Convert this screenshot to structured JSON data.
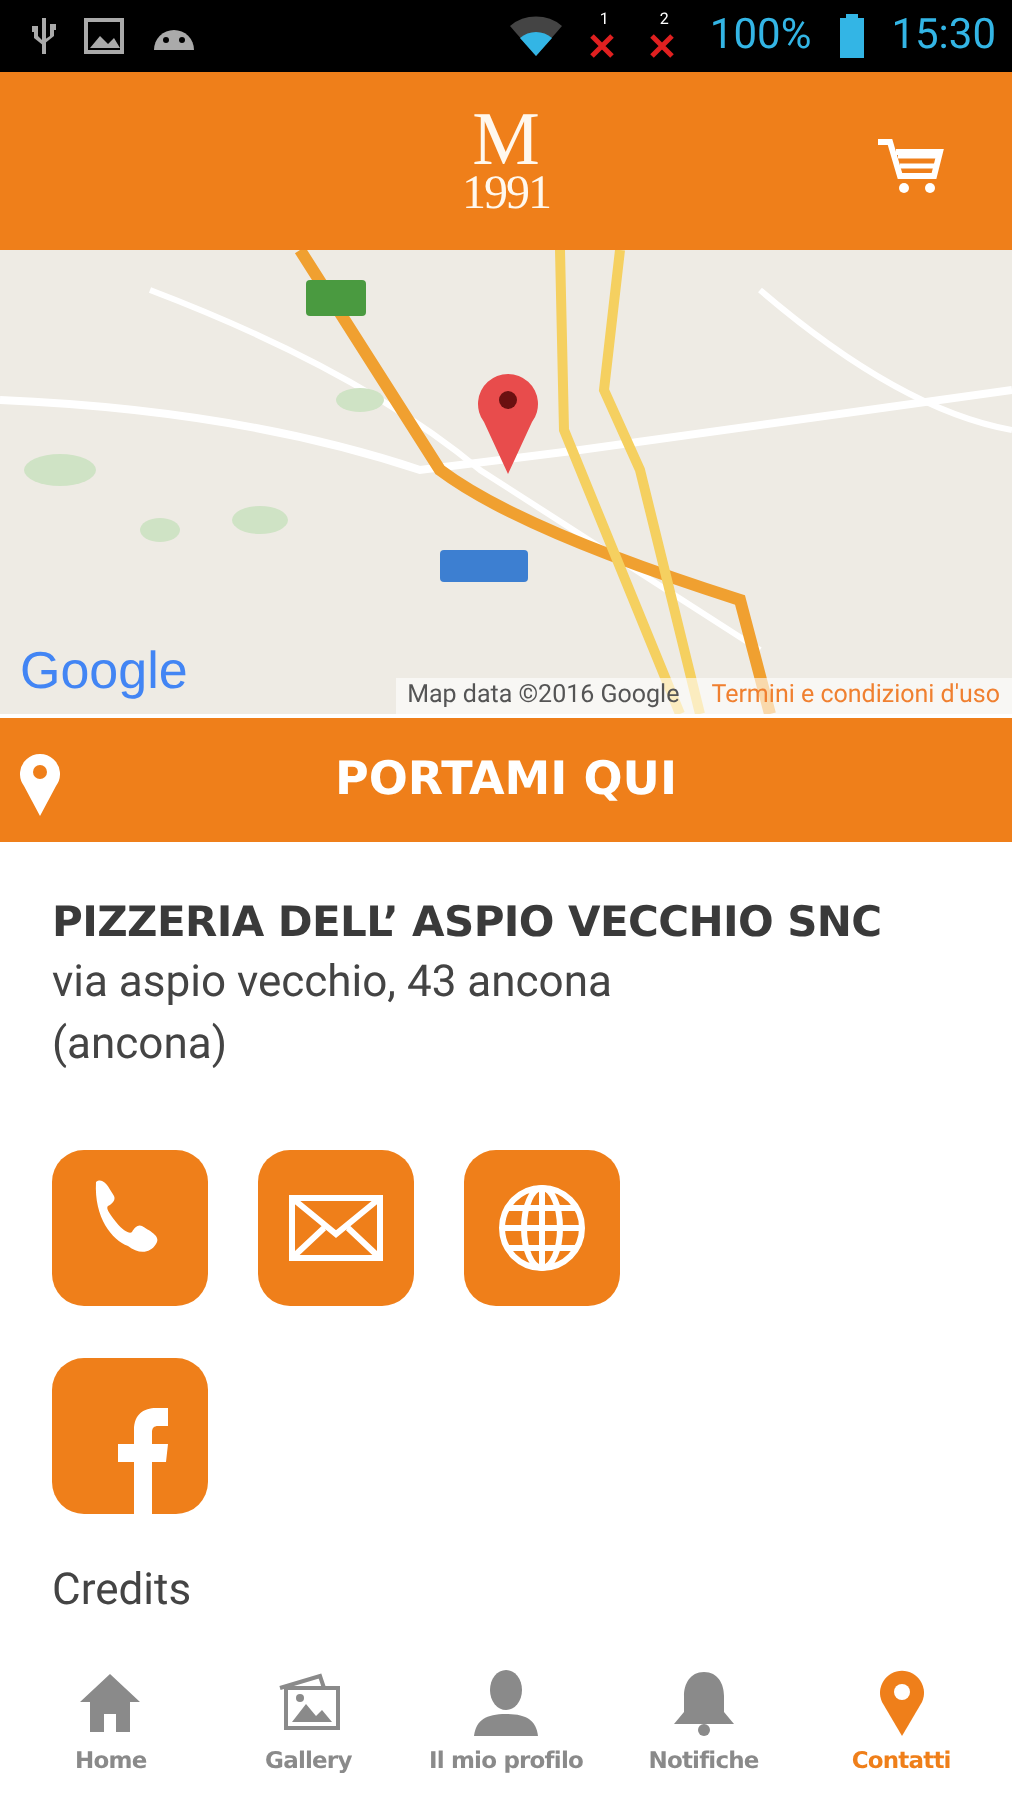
{
  "status_bar": {
    "sim_labels": [
      "1",
      "2"
    ],
    "battery": "100%",
    "time": "15:30"
  },
  "header": {
    "logo_letter": "M",
    "logo_year": "1991"
  },
  "map": {
    "attribution": "Map data ©2016 Google",
    "terms": "Termini e condizioni d'uso",
    "brand": "Google"
  },
  "directions_button": {
    "label": "PORTAMI QUI"
  },
  "place": {
    "name": "PIZZERIA DELL’ ASPIO VECCHIO SNC",
    "address": "via aspio vecchio, 43 ancona (ancona)"
  },
  "actions": [
    {
      "kind": "phone"
    },
    {
      "kind": "email"
    },
    {
      "kind": "web"
    },
    {
      "kind": "facebook"
    }
  ],
  "credits": "Credits",
  "nav": [
    {
      "kind": "home",
      "label": "Home",
      "selected": false
    },
    {
      "kind": "gallery",
      "label": "Gallery",
      "selected": false
    },
    {
      "kind": "profile",
      "label": "Il mio profilo",
      "selected": false
    },
    {
      "kind": "bell",
      "label": "Notifiche",
      "selected": false
    },
    {
      "kind": "pin",
      "label": "Contatti",
      "selected": true
    }
  ]
}
